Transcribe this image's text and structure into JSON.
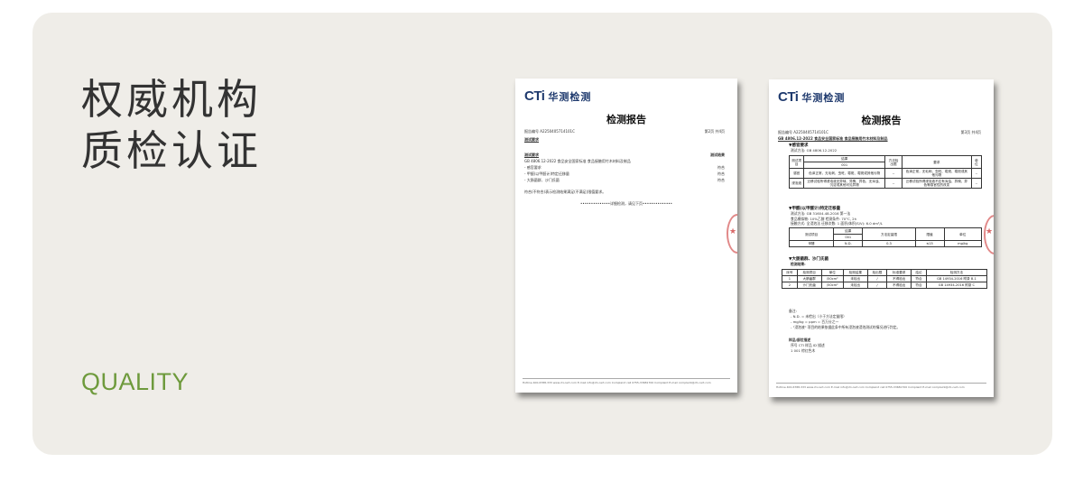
{
  "heading": {
    "line1": "权威机构",
    "line2": "质检认证"
  },
  "tagline": "QUALITY",
  "colors": {
    "card_bg": "#efede8",
    "accent_green": "#6e9a3c",
    "heading_text": "#333333",
    "logo_blue": "#1f3a6e"
  },
  "documents": [
    {
      "logo_latin": "CTi",
      "logo_cn": "华测检测",
      "title": "检测报告",
      "report_no": "报告编号  A2250405714101C",
      "page": "第2页 共4页",
      "section1": "测试要求",
      "section2": "测试要求",
      "result_header": "测试结果",
      "standard": "GB 4806.12-2022  食品安全国家标准  食品接触用竹木材料及制品",
      "items": [
        {
          "label": "-   感官要求",
          "result": "符合"
        },
        {
          "label": "-   甲醛(以甲醛计)特定迁移量",
          "result": "符合"
        },
        {
          "label": "-   大肠菌群、沙门氏菌",
          "result": "符合"
        }
      ],
      "note": "符合(不符合)表示检测结果满足(不满足)限值要求。",
      "continued": "••••••••••••••详细检测，请见下页••••••••••••••",
      "footer": "Hotline 400-6788-333   www.cti-cert.com   E-mail info@cti-cert.com   Complaint call 0755-33681700   Complaint E-mail complaint@cti-cert.com"
    },
    {
      "logo_latin": "CTi",
      "logo_cn": "华测检测",
      "title": "检测报告",
      "report_no": "报告编号  A2250405714101C",
      "page": "第3页 共4页",
      "standard": "GB 4806.12-2022  食品安全国家标准  食品接触用竹木材料及制品",
      "sec_sensory": "▼感官要求",
      "method1": "测试方法: GB 4806.12-2022",
      "sensory_headers": [
        "测试项目",
        "结果",
        "方法检出限",
        "要求",
        "单位"
      ],
      "sensory_sample": "001",
      "sensory_rows": [
        [
          "感官",
          "色泽正常，无毛刺、虫蛀、霉斑、霉斑或其他污物",
          "--",
          "色泽正常，无毛刺、虫蛀、霉斑、霉斑或其他污物",
          "--"
        ],
        [
          "浸泡液",
          "迁移试验所得浸泡液无异味、异臭、异色，无浑浊、沉淀或其他可见异物",
          "--",
          "迁移试验所得浸泡液不应有浑浊、异嗅、异色等感官性的改变",
          "--"
        ]
      ],
      "sec_formaldehyde": "▼甲醛(以甲醛计)特定迁移量",
      "method2": "测试方法: GB 31604.48-2016 第一法",
      "sim1": "食品模拟物: 10%乙醇   检测条件: 70°C, 2h",
      "sim2": "接触方式: 全浸泡法   迁移次数: 1   面积/体积(S/V): 6.0 dm²/L",
      "form_headers": [
        "测试项目",
        "结果",
        "方法定量限",
        "限值",
        "单位"
      ],
      "form_sample": "001",
      "form_row": [
        "甲醛",
        "N.D.",
        "0.3",
        "≤15",
        "mg/kg"
      ],
      "sec_micro": "▼大肠菌群、沙门氏菌",
      "micro_sub": "检测结果:",
      "micro_headers": [
        "序号",
        "检测项目",
        "单位",
        "检测结果",
        "检出限",
        "标准要求",
        "结论",
        "检测方法"
      ],
      "micro_rows": [
        [
          "1",
          "大肠菌群",
          "/50cm²",
          "未检出",
          "/",
          "不得检出",
          "符合",
          "GB 14934-2016 附录 B.1"
        ],
        [
          "2",
          "沙门氏菌",
          "/50cm²",
          "未检出",
          "/",
          "不得检出",
          "符合",
          "GB 14934-2016 附录 C"
        ]
      ],
      "notes_title": "备注:",
      "notes": [
        "-   N.D. = 未检出（小于方法定量限）",
        "-   mg/kg = ppm = 百万分之一",
        "-   \"浸泡液\" 项目的结果依据此条中所有浸泡液浸泡测试的情况进行判定。"
      ],
      "sample_title": "样品/部位描述",
      "sample_headers": "序号     CTI 样品 ID     描述",
      "sample_row": "1             001           棕红色木",
      "footer": "Hotline 400-6788-333   www.cti-cert.com   E-mail info@cti-cert.com   Complaint call 0755-33681700   Complaint E-mail complaint@cti-cert.com"
    }
  ]
}
